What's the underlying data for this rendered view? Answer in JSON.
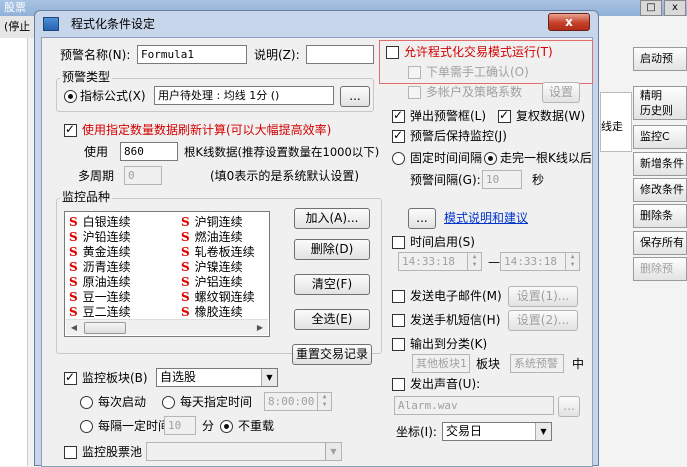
{
  "background": {
    "status_text": "(停止",
    "top_text": "股票",
    "right_buttons": [
      "启动预",
      "精明",
      "历史则",
      "监控C",
      "新增条件",
      "修改条件",
      "删除条",
      "保存所有",
      "删除预"
    ],
    "right_fragment": "线走",
    "win_buttons": [
      "□",
      "x"
    ]
  },
  "dialog": {
    "title": "程式化条件设定",
    "close_label": "x",
    "name_label": "预警名称(N):",
    "name_value": "Formula1",
    "desc_label": "说明(Z):",
    "desc_value": "",
    "type_group": "预警类型",
    "indicator_label": "指标公式(X)",
    "indicator_value": "用户待处理 : 均线 1分 ()",
    "indicator_btn": "...",
    "use_count_label": "使用指定数量数据刷新计算(可以大幅提高效率)",
    "use_label": "使用",
    "use_value": "860",
    "kline_note": "根K线数据(推荐设置数量在1000以下)",
    "multi_label": "多周期",
    "multi_value": "0",
    "zero_note": "(填0表示的是系统默认设置)",
    "monitor_group": "监控品种",
    "list_items": [
      [
        "白银连续",
        "沪铜连续"
      ],
      [
        "沪铅连续",
        "燃油连续"
      ],
      [
        "黄金连续",
        "轧卷板连续"
      ],
      [
        "沥青连续",
        "沪镍连续"
      ],
      [
        "原油连续",
        "沪铝连续"
      ],
      [
        "豆一连续",
        "螺纹钢连续"
      ],
      [
        "豆二连续",
        "橡胶连续"
      ]
    ],
    "list_marker": "S",
    "add_btn": "加入(A)...",
    "del_btn": "删除(D)",
    "clear_btn": "清空(F)",
    "select_all_btn": "全选(E)",
    "reset_btn": "重置交易记录",
    "monitor_block_label": "监控板块(B)",
    "monitor_block_value": "自选股",
    "each_start_label": "每次启动",
    "daily_time_label": "每天指定时间",
    "daily_time_value": "8:00:00",
    "interval_label": "每隔一定时间",
    "interval_value": "10",
    "minute_label": "分",
    "no_reload_label": "不重载",
    "stock_pool_label": "监控股票池",
    "allow_label": "允许程式化交易模式运行(T)",
    "manual_confirm_label": "下单需手工确认(O)",
    "multi_account_label": "多帐户及策略系数",
    "settings_btn": "设置",
    "popup_label": "弹出预警框(L)",
    "reuse_label": "复权数据(W)",
    "keep_monitor_label": "预警后保持监控(J)",
    "fixed_interval_label": "固定时间间隔",
    "per_kline_label": "走完一根K线以后",
    "alert_interval_label": "预警间隔(G):",
    "alert_interval_value": "10",
    "seconds_label": "秒",
    "explain_btn": "...",
    "explain_link": "模式说明和建议",
    "time_enable_label": "时间启用(S)",
    "time_from": "14:33:18",
    "time_dash": "—",
    "time_to": "14:33:18",
    "email_label": "发送电子邮件(M)",
    "email_btn": "设置(1)...",
    "sms_label": "发送手机短信(H)",
    "sms_btn": "设置(2)...",
    "output_label": "输出到分类(K)",
    "output_block": "其他板块1",
    "block_word": "板块",
    "output_sys": "系统预警",
    "middle_word": "中",
    "sound_label": "发出声音(U):",
    "sound_value": "Alarm.wav",
    "sound_btn": "...",
    "coord_label": "坐标(I):",
    "coord_value": "交易日"
  }
}
